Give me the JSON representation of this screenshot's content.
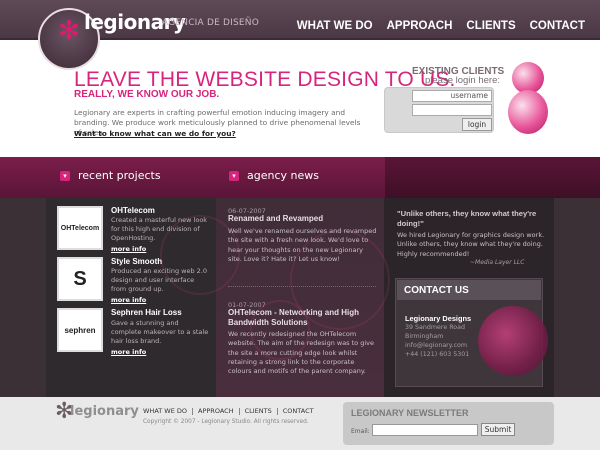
{
  "header": {
    "logo_text": "legionary",
    "tagline": "AGENCIA DE DISEÑO",
    "nav": [
      "WHAT WE DO",
      "APPROACH",
      "CLIENTS",
      "CONTACT"
    ]
  },
  "hero": {
    "title": "LEAVE THE WEBSITE DESIGN TO US.",
    "subtitle": "REALLY, WE KNOW OUR JOB.",
    "body": "Legionary are experts in crafting powerful emotion inducing imagery and branding. We produce work meticulously planned to drive phenomenal levels of sales.",
    "link": "Want to know what can we do for you?"
  },
  "login": {
    "heading": "EXISTING CLIENTS",
    "subheading": "please login here:",
    "username_placeholder": "username",
    "button": "login"
  },
  "sections": {
    "projects_heading": "recent projects",
    "news_heading": "agency news"
  },
  "projects": [
    {
      "thumb": "OHTelecom",
      "title": "OHTelecom",
      "text": "Created a masterful new look for this high end division of OpenHosting.",
      "more": "more info"
    },
    {
      "thumb": "S",
      "title": "Style Smooth",
      "text": "Produced an exciting web 2.0 design and user interface from ground up.",
      "more": "more info"
    },
    {
      "thumb": "sephren",
      "title": "Sephren Hair Loss",
      "text": "Gave a stunning and complete makeover to a stale hair loss brand.",
      "more": "more info"
    }
  ],
  "news": [
    {
      "date": "06-07-2007",
      "title": "Renamed and Revamped",
      "text": "Well we've renamed ourselves and revamped the site with a fresh new look. We'd love to hear your thoughts on the new Legionary site. Love it? Hate it? Let us know!"
    },
    {
      "date": "01-07-2007",
      "title": "OHTelecom - Networking and High Bandwidth Solutions",
      "text": "We recently redesigned the OHTelecom website. The aim of the redesign was to give the site a more cutting edge look whilst retaining a strong link to the corporate colours and motifs of the parent company."
    }
  ],
  "testimonial": {
    "quote": "\"Unlike others, they know what they're doing!\"",
    "text": "We hired Legionary for graphics design work. Unlike others, they know what they're doing. Highly recommended!",
    "source": "~Media Layer LLC"
  },
  "contact": {
    "heading": "CONTACT US",
    "name": "Legionary Designs",
    "lines": [
      "39 Sandmere Road",
      "Birmingham",
      "info@legionary.com",
      "+44 (121) 603 5301"
    ]
  },
  "footer": {
    "logo_text": "legionary",
    "nav": [
      "WHAT WE DO",
      "APPROACH",
      "CLIENTS",
      "CONTACT"
    ],
    "copyright": "Copyright © 2007 - Legionary Studio. All rights reserved.",
    "newsletter_title": "LEGIONARY NEWSLETTER",
    "email_label": "Email:",
    "submit": "Submit"
  },
  "colors": {
    "accent": "#d7257d",
    "header_bg": "#4b3844",
    "band": "#7b1d4b",
    "dark_bg": "#3a3036"
  }
}
